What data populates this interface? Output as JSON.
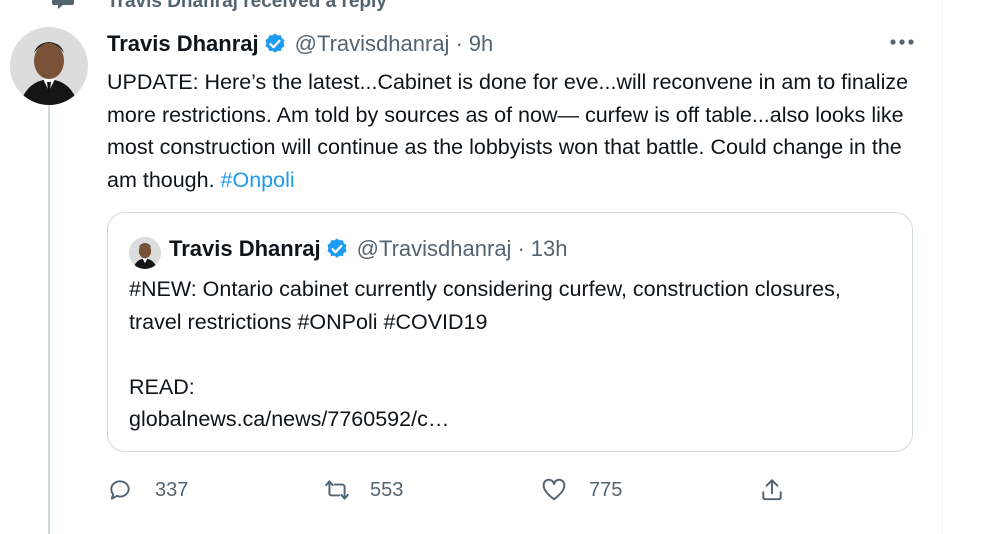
{
  "context": {
    "text": "Travis Dhanraj received a reply",
    "icon": "reply-bubble-icon"
  },
  "tweet": {
    "author_name": "Travis Dhanraj",
    "handle": "@Travisdhanraj",
    "separator": "·",
    "time": "9h",
    "text_main": "UPDATE: Here’s the latest...Cabinet is done for eve...will reconvene in am to finalize more restrictions. Am told by sources as of now— curfew is off table...also looks like most construction will continue as the lobbyists won that battle. Could change in the am though.  ",
    "hashtag": "#Onpoli",
    "verified_icon": "verified-badge-icon",
    "more_icon": "more-options-icon"
  },
  "quote": {
    "author_name": "Travis Dhanraj",
    "handle": "@Travisdhanraj",
    "separator": "·",
    "time": "13h",
    "text": "#NEW: Ontario cabinet currently considering curfew, construction closures, travel restrictions #ONPoli #COVID19\n\nREAD:\nglobalnews.ca/news/7760592/c…"
  },
  "actions": {
    "reply_count": "337",
    "retweet_count": "553",
    "like_count": "775",
    "reply_icon": "reply-icon",
    "retweet_icon": "retweet-icon",
    "like_icon": "like-heart-icon",
    "share_icon": "share-icon"
  },
  "colors": {
    "accent": "#1d9bf0",
    "secondary_text": "#536471",
    "border": "#cfd9de"
  }
}
